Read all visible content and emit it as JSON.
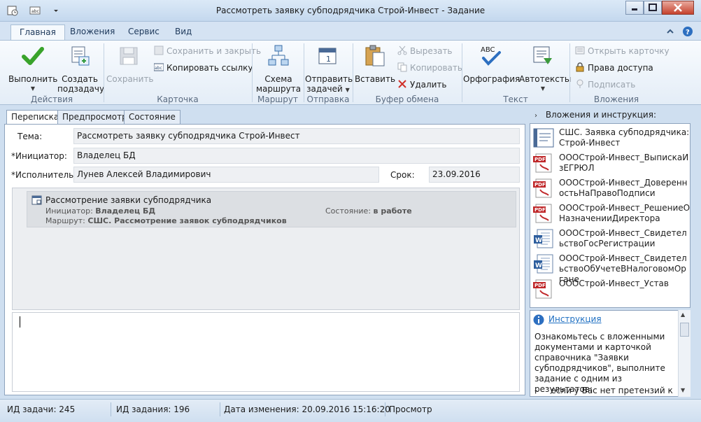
{
  "window": {
    "title": "Рассмотреть заявку субподрядчика Строй-Инвест - Задание"
  },
  "ribbon_tabs": [
    "Главная",
    "Вложения",
    "Сервис",
    "Вид"
  ],
  "ribbon": {
    "execute": "Выполнить",
    "create_subtask_1": "Создать",
    "create_subtask_2": "подзадачу",
    "group_actions": "Действия",
    "save": "Сохранить",
    "save_close": "Сохранить и закрыть",
    "copy_link": "Копировать ссылку",
    "group_card": "Карточка",
    "route_scheme_1": "Схема",
    "route_scheme_2": "маршрута",
    "group_route": "Маршрут",
    "send_tasks_1": "Отправить",
    "send_tasks_2": "задачей",
    "group_send": "Отправка",
    "paste": "Вставить",
    "cut": "Вырезать",
    "copy": "Копировать",
    "delete": "Удалить",
    "group_clipboard": "Буфер обмена",
    "spelling": "Орфография",
    "autotext": "Автотексты",
    "group_text": "Текст",
    "open_card": "Открыть карточку",
    "access_rights": "Права доступа",
    "sign": "Подписать",
    "group_attachments": "Вложения",
    "abc": "ABC"
  },
  "content_tabs": [
    "Переписка",
    "Предпросмотр",
    "Состояние"
  ],
  "form": {
    "subject_label": "Тема:",
    "subject_value": "Рассмотреть заявку субподрядчика Строй-Инвест",
    "initiator_label": "*Инициатор:",
    "initiator_value": "Владелец БД",
    "executor_label": "*Исполнитель:",
    "executor_value": "Лунев Алексей Владимирович",
    "deadline_label": "Срок:",
    "deadline_value": "23.09.2016"
  },
  "route_card": {
    "title": "Рассмотрение заявки субподрядчика",
    "initiator_label": "Инициатор:",
    "initiator_value": "Владелец БД",
    "route_label": "Маршрут:",
    "route_value": "СШС. Рассмотрение заявок субподрядчиков",
    "state_label": "Состояние:",
    "state_value": "в работе"
  },
  "right_pane": {
    "header": "Вложения и инструкция:",
    "attachments": [
      {
        "name": "СШС. Заявка субподрядчика: Строй-Инвест",
        "type": "card"
      },
      {
        "name": "ОООСтрой-Инвест_ВыпискаИзЕГРЮЛ",
        "type": "pdf"
      },
      {
        "name": "ОООСтрой-Инвест_ДоверенностьНаПравоПодписи",
        "type": "pdf"
      },
      {
        "name": "ОООСтрой-Инвест_РешениеОНазначенииДиректора",
        "type": "pdf"
      },
      {
        "name": "ОООСтрой-Инвест_СвидетельствоГосРегистрации",
        "type": "doc"
      },
      {
        "name": "ОООСтрой-Инвест_СвидетельствоОбУчетеВНалоговомОргане",
        "type": "doc"
      },
      {
        "name": "ОООСтрой-Инвест_Устав",
        "type": "pdf"
      }
    ],
    "instruction_link": "Инструкция",
    "instruction_text": "Ознакомьтесь с вложенными документами и карточкой справочника \"Заявки субподрядчиков\", выполните задание с одним из результатов:",
    "instruction_bullet": "-     если у Вас нет претензий к"
  },
  "status_bar": {
    "task_id": "ИД задачи: 245",
    "job_id": "ИД задания: 196",
    "modified": "Дата изменения: 20.09.2016 15:16:20",
    "mode": "Просмотр"
  },
  "colors": {
    "accent": "#1e6fc2",
    "pdf_red": "#c0282a"
  }
}
